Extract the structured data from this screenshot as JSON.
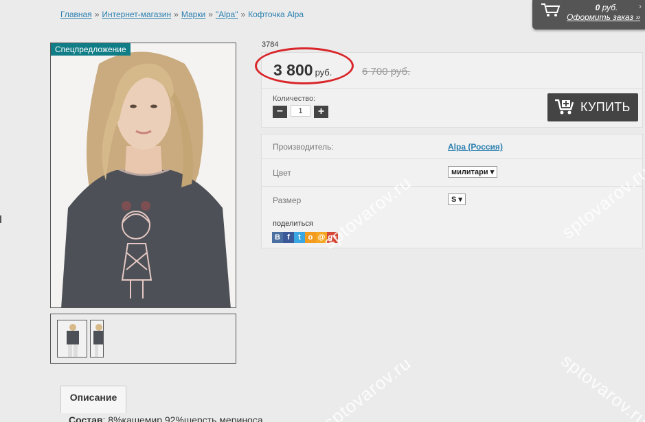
{
  "breadcrumb": {
    "items": [
      "Главная",
      "Интернет-магазин",
      "Марки",
      "\"Alpa\""
    ],
    "separator": "»",
    "current": "Кофточка Alpa"
  },
  "cart": {
    "icon": "cart-icon",
    "amount": "0",
    "currency": "руб.",
    "order_link": "Оформить заказ »"
  },
  "product": {
    "badge": "Спецпредложение",
    "sku": "3784",
    "price": "3 800",
    "price_currency": "руб.",
    "old_price": "6 700 руб.",
    "quantity_label": "Количество:",
    "quantity": "1",
    "minus": "−",
    "plus": "+",
    "buy_label": "КУПИТЬ"
  },
  "attributes": {
    "manufacturer_label": "Производитель:",
    "manufacturer_value": "Alpa (Россия)",
    "color_label": "Цвет",
    "color_value": "милитари",
    "size_label": "Размер",
    "size_value": "S",
    "share_label": "поделиться",
    "share_icons": [
      "vk-icon",
      "facebook-icon",
      "twitter-icon",
      "odnoklassniki-icon",
      "mailru-icon",
      "googleplus-icon"
    ]
  },
  "description": {
    "tab_label": "Описание",
    "composition_label": "Состав",
    "composition_text": ": 8%кашемир 92%шерсть мериноса"
  },
  "watermark": "sptovarov.ru",
  "colors": {
    "accent_link": "#2a7fb0",
    "badge": "#117d86",
    "highlight_circle": "#d9262a",
    "dark_button": "#444444"
  }
}
